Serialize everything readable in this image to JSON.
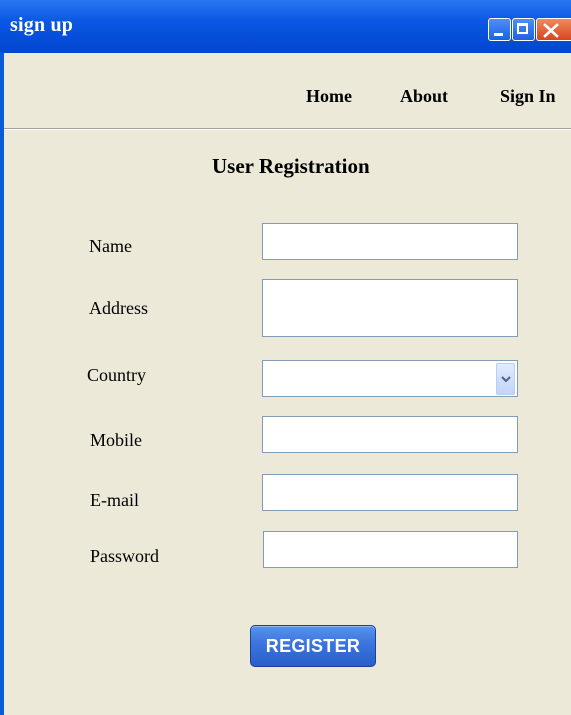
{
  "window": {
    "title": "sign up",
    "controls": [
      "minimize-icon",
      "maximize-icon",
      "close-icon"
    ]
  },
  "nav": {
    "home": "Home",
    "about": "About",
    "sign_in": "Sign In"
  },
  "form": {
    "heading": "User Registration",
    "fields": {
      "name": {
        "label": "Name",
        "value": ""
      },
      "address": {
        "label": "Address",
        "value": ""
      },
      "country": {
        "label": "Country",
        "value": ""
      },
      "mobile": {
        "label": "Mobile",
        "value": ""
      },
      "email": {
        "label": "E-mail",
        "value": ""
      },
      "password": {
        "label": "Password",
        "value": ""
      }
    },
    "register_label": "REGISTER"
  },
  "colors": {
    "titlebar": "#0a57e3",
    "window_bg": "#ece9d8",
    "field_border": "#7f9db9",
    "button": "#3a74dd"
  }
}
